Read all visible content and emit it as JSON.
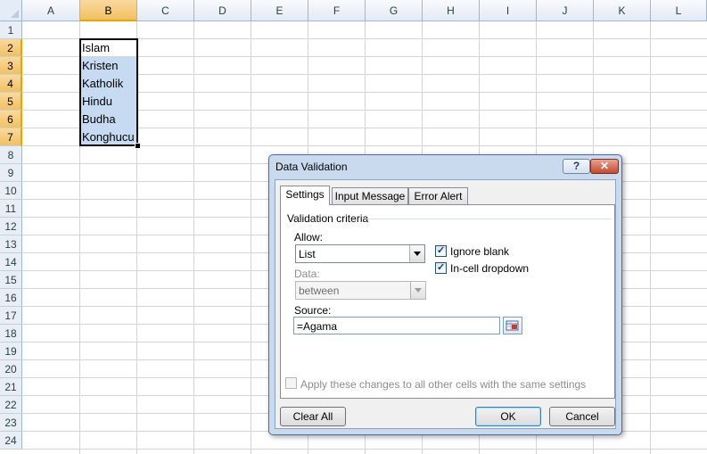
{
  "sheet": {
    "columns": [
      "A",
      "B",
      "C",
      "D",
      "E",
      "F",
      "G",
      "H",
      "I",
      "J",
      "K",
      "L"
    ],
    "rows": [
      "1",
      "2",
      "3",
      "4",
      "5",
      "6",
      "7",
      "8",
      "9",
      "10",
      "11",
      "12",
      "13",
      "14",
      "15",
      "16",
      "17",
      "18",
      "19",
      "20",
      "21",
      "22",
      "23",
      "24"
    ],
    "selected_column": "B",
    "cells": {
      "b2": "Islam",
      "b3": "Kristen",
      "b4": "Katholik",
      "b5": "Hindu",
      "b6": "Budha",
      "b7": "Konghucu"
    }
  },
  "dialog": {
    "title": "Data Validation",
    "help_label": "?",
    "close_label": "✕",
    "tabs": [
      "Settings",
      "Input Message",
      "Error Alert"
    ],
    "active_tab": "Settings",
    "group_label": "Validation criteria",
    "allow": {
      "label": "Allow:",
      "value": "List"
    },
    "ignore_blank": {
      "label": "Ignore blank",
      "checked": true
    },
    "in_cell_dropdown": {
      "label": "In-cell dropdown",
      "checked": true
    },
    "data": {
      "label": "Data:",
      "value": "between",
      "disabled": true
    },
    "source": {
      "label": "Source:",
      "value": "=Agama"
    },
    "apply_all": {
      "label": "Apply these changes to all other cells with the same settings",
      "checked": false,
      "disabled": true
    },
    "clear_all_label": "Clear All",
    "ok_label": "OK",
    "cancel_label": "Cancel"
  }
}
